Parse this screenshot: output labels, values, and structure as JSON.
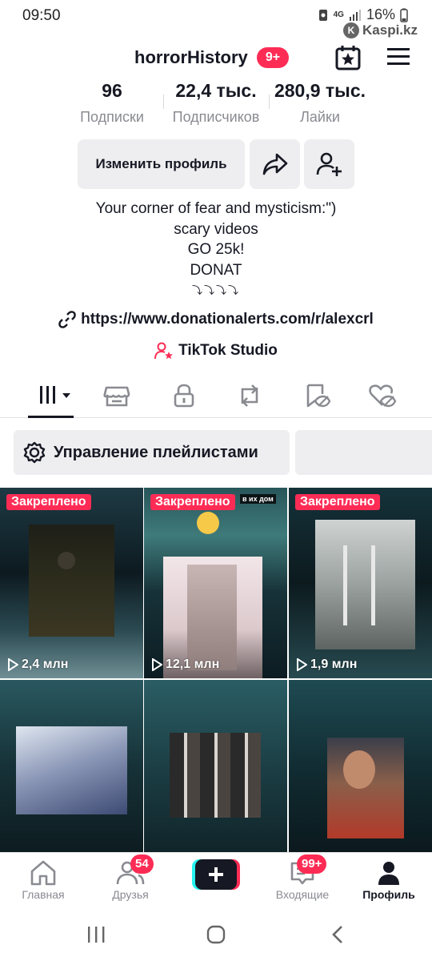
{
  "status_bar": {
    "time": "09:50",
    "network": "4G",
    "battery": "16%",
    "watermark": "Kaspi.kz"
  },
  "profile": {
    "username": "horrorHistory",
    "notifications_badge": "9+",
    "stats": [
      {
        "value": "96",
        "label": "Подписки"
      },
      {
        "value": "22,4 тыс.",
        "label": "Подписчиков"
      },
      {
        "value": "280,9 тыс.",
        "label": "Лайки"
      }
    ],
    "edit_profile_label": "Изменить профиль",
    "bio_lines": [
      "Your corner of fear and mysticism:\")",
      "scary videos",
      "GO 25k!",
      "DONAT",
      "⤵⤵⤵⤵"
    ],
    "link": "https://www.donationalerts.com/r/alexcrl",
    "studio": "TikTok Studio"
  },
  "playlists": {
    "manage_label": "Управление плейлистами"
  },
  "videos": [
    {
      "pinned": "Закреплено",
      "views": "2,4 млн"
    },
    {
      "pinned": "Закреплено",
      "views": "12,1 млн",
      "overlay_text": "в их дом"
    },
    {
      "pinned": "Закреплено",
      "views": "1,9 млн"
    },
    {
      "pinned": "",
      "views": ""
    },
    {
      "pinned": "",
      "views": ""
    },
    {
      "pinned": "",
      "views": ""
    }
  ],
  "bottom_nav": [
    {
      "label": "Главная",
      "icon": "home-icon"
    },
    {
      "label": "Друзья",
      "icon": "friends-icon",
      "badge": "54"
    },
    {
      "label": "",
      "icon": "plus-icon"
    },
    {
      "label": "Входящие",
      "icon": "inbox-icon",
      "badge": "99+"
    },
    {
      "label": "Профиль",
      "icon": "profile-icon"
    }
  ],
  "colors": {
    "accent": "#fe2c55",
    "text": "#161823",
    "muted": "#8a8b91",
    "button_bg": "#eeeef0"
  }
}
